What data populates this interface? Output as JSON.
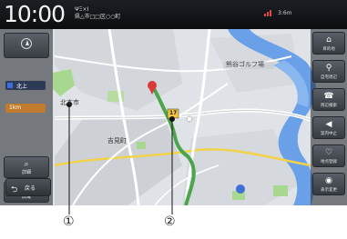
{
  "status": {
    "time": "10:00",
    "line1": "ΨΞ×Ι",
    "line2": "県△市□□区○○町",
    "signal_text": "3:6m"
  },
  "left_panel": {
    "compass_caption": "",
    "north_label": "北上",
    "scale_label": "1km",
    "zoom_in_label": "詳細",
    "zoom_out_label": "広域",
    "back_label": "戻る",
    "back_glyph": "⮌"
  },
  "right_panel": {
    "buttons": [
      {
        "icon": "⌂",
        "label": "目的地",
        "icon_name": "home-icon"
      },
      {
        "icon": "⚲",
        "label": "自宅周辺",
        "icon_name": "search-icon"
      },
      {
        "icon": "☎",
        "label": "周辺検索",
        "icon_name": "phone-icon"
      },
      {
        "icon": "◀",
        "label": "案内中止",
        "icon_name": "volume-icon"
      },
      {
        "icon": "♡",
        "label": "地点登録",
        "icon_name": "favorite-icon"
      },
      {
        "icon": "◉",
        "label": "表示変更",
        "icon_name": "display-icon"
      }
    ]
  },
  "map": {
    "labels": [
      {
        "id": "cityA",
        "text": "北本市"
      },
      {
        "id": "cityB",
        "text": "吉見町"
      },
      {
        "id": "cityC",
        "text": "熊谷ゴルフ場"
      },
      {
        "id": "route_no",
        "text": "17"
      }
    ],
    "colors": {
      "land": "#dfe2e6",
      "urban": "#cfd3d8",
      "river": "#6aa0e8",
      "green": "#9fd48a",
      "route": "#4aa64a",
      "road_major": "#ffffff",
      "road_yellow": "#f2d24a"
    }
  },
  "callouts": {
    "one": "①",
    "two": "②"
  }
}
